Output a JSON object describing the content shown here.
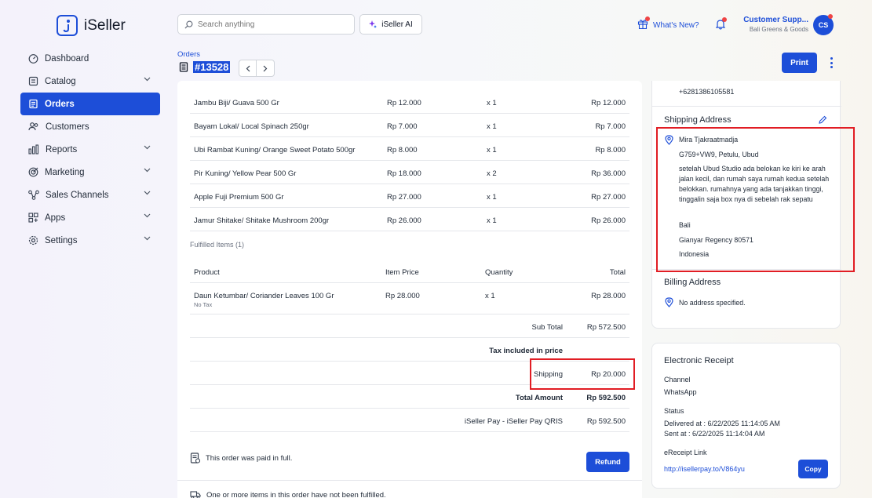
{
  "brand": {
    "name": "iSeller"
  },
  "header": {
    "search_placeholder": "Search anything",
    "ai_label": "iSeller AI",
    "whats_new": "What's New?",
    "user_name": "Customer Supp...",
    "user_store": "Bali Greens & Goods",
    "avatar_initials": "CS"
  },
  "sidebar": {
    "items": [
      {
        "label": "Dashboard",
        "icon": "dashboard-icon"
      },
      {
        "label": "Catalog",
        "icon": "catalog-icon"
      },
      {
        "label": "Orders",
        "icon": "orders-icon"
      },
      {
        "label": "Customers",
        "icon": "customers-icon"
      },
      {
        "label": "Reports",
        "icon": "reports-icon"
      },
      {
        "label": "Marketing",
        "icon": "marketing-icon"
      },
      {
        "label": "Sales Channels",
        "icon": "sales-channels-icon"
      },
      {
        "label": "Apps",
        "icon": "apps-icon"
      },
      {
        "label": "Settings",
        "icon": "settings-icon"
      }
    ]
  },
  "order": {
    "breadcrumb": "Orders",
    "number": "#13528",
    "print_label": "Print"
  },
  "items": [
    {
      "product": "Jambu Biji/ Guava 500 Gr",
      "price": "Rp 12.000",
      "qty": "x 1",
      "total": "Rp 12.000"
    },
    {
      "product": "Bayam Lokal/ Local Spinach 250gr",
      "price": "Rp 7.000",
      "qty": "x 1",
      "total": "Rp 7.000"
    },
    {
      "product": "Ubi Rambat Kuning/ Orange Sweet Potato 500gr",
      "price": "Rp 8.000",
      "qty": "x 1",
      "total": "Rp 8.000"
    },
    {
      "product": "Pir Kuning/ Yellow Pear 500 Gr",
      "price": "Rp 18.000",
      "qty": "x 2",
      "total": "Rp 36.000"
    },
    {
      "product": "Apple Fuji Premium 500 Gr",
      "price": "Rp 27.000",
      "qty": "x 1",
      "total": "Rp 27.000"
    },
    {
      "product": "Jamur Shitake/ Shitake Mushroom 200gr",
      "price": "Rp 26.000",
      "qty": "x 1",
      "total": "Rp 26.000"
    }
  ],
  "fulfilled": {
    "label": "Fulfilled Items (1)",
    "headers": {
      "product": "Product",
      "price": "Item Price",
      "qty": "Quantity",
      "total": "Total"
    },
    "items": [
      {
        "product": "Daun Ketumbar/ Coriander Leaves 100 Gr",
        "note": "No Tax",
        "price": "Rp 28.000",
        "qty": "x 1",
        "total": "Rp 28.000"
      }
    ]
  },
  "summary": {
    "subtotal_label": "Sub Total",
    "subtotal": "Rp 572.500",
    "tax_label": "Tax included in price",
    "shipping_label": "Shipping",
    "shipping": "Rp 20.000",
    "total_label": "Total Amount",
    "total": "Rp 592.500",
    "payment_label": "iSeller Pay - iSeller Pay QRIS",
    "payment": "Rp 592.500"
  },
  "status": {
    "paid": "This order was paid in full.",
    "refund_label": "Refund",
    "unfulfilled": "One or more items in this order have not been fulfilled."
  },
  "customer": {
    "phone": "+6281386105581",
    "shipping_title": "Shipping Address",
    "shipping": {
      "name": "Mira Tjakraatmadja",
      "line1": "G759+VW9, Petulu, Ubud",
      "note": "setelah Ubud Studio ada belokan ke kiri ke arah jalan kecil, dan rumah saya rumah kedua setelah belokkan. rumahnya yang ada tanjakkan tinggi, tinggalin saja box nya di sebelah rak sepatu",
      "province": "Bali",
      "city": "Gianyar Regency 80571",
      "country": "Indonesia"
    },
    "billing_title": "Billing Address",
    "billing": "No address specified."
  },
  "receipt": {
    "title": "Electronic Receipt",
    "channel_label": "Channel",
    "channel": "WhatsApp",
    "status_label": "Status",
    "delivered": "Delivered at : 6/22/2025 11:14:05 AM",
    "sent": "Sent at : 6/22/2025 11:14:04 AM",
    "link_label": "eReceipt Link",
    "link": "http://isellerpay.to/V864yu",
    "copy_label": "Copy"
  },
  "colors": {
    "accent": "#1d4ed8",
    "highlight": "#e11d24"
  }
}
